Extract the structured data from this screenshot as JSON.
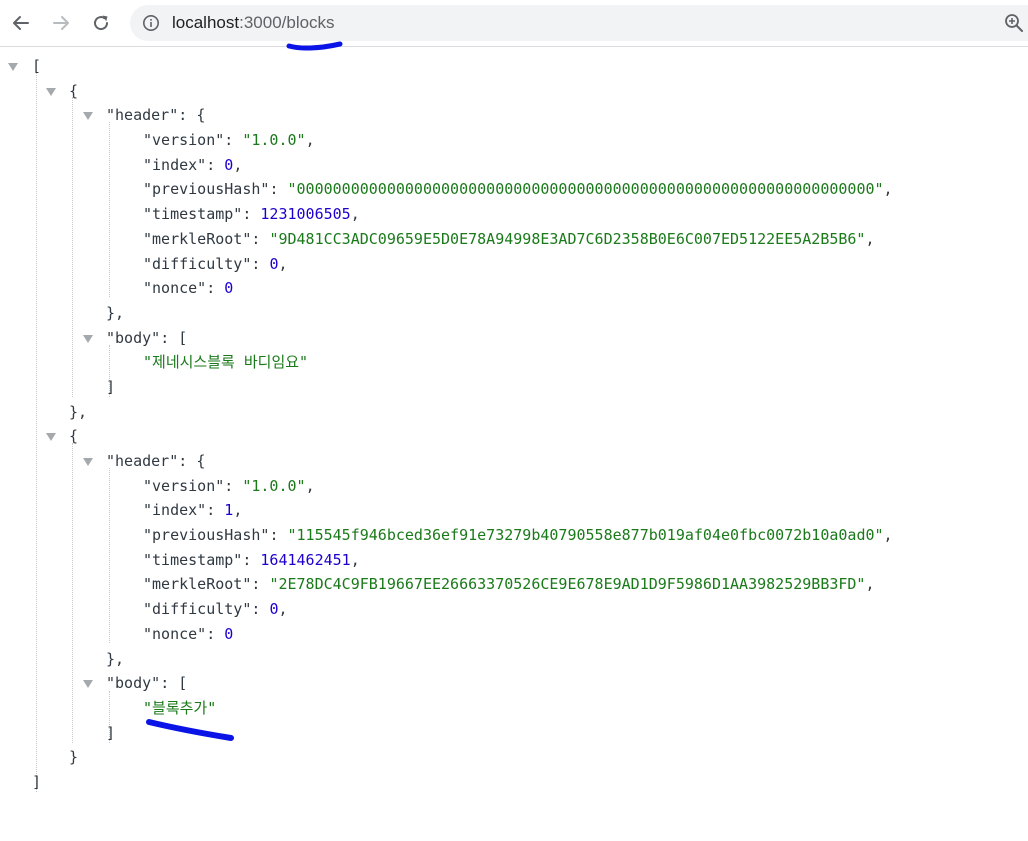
{
  "browser": {
    "url_host": "localhost",
    "url_path": ":3000/blocks"
  },
  "json": {
    "open_array": "[",
    "close_array": "]",
    "open_obj": "{",
    "close_obj": "}",
    "close_obj_comma": "},",
    "open_arr": "[",
    "close_arr": "]",
    "keys": {
      "header": "\"header\"",
      "body": "\"body\"",
      "version": "\"version\"",
      "index": "\"index\"",
      "previousHash": "\"previousHash\"",
      "timestamp": "\"timestamp\"",
      "merkleRoot": "\"merkleRoot\"",
      "difficulty": "\"difficulty\"",
      "nonce": "\"nonce\""
    },
    "blocks": [
      {
        "version": "\"1.0.0\"",
        "index": "0",
        "previousHash": "\"0000000000000000000000000000000000000000000000000000000000000000\"",
        "timestamp": "1231006505",
        "merkleRoot": "\"9D481CC3ADC09659E5D0E78A94998E3AD7C6D2358B0E6C007ED5122EE5A2B5B6\"",
        "difficulty": "0",
        "nonce": "0",
        "body_item": "\"제네시스블록 바디임요\""
      },
      {
        "version": "\"1.0.0\"",
        "index": "1",
        "previousHash": "\"115545f946bced36ef91e73279b40790558e877b019af04e0fbc0072b10a0ad0\"",
        "timestamp": "1641462451",
        "merkleRoot": "\"2E78DC4C9FB19667EE26663370526CE9E678E9AD1D9F5986D1AA3982529BB3FD\"",
        "difficulty": "0",
        "nonce": "0",
        "body_item": "\"블록추가\""
      }
    ]
  },
  "colors": {
    "string": "#1a7a1a",
    "number": "#1c00cf",
    "annotation": "#0a14e6"
  }
}
